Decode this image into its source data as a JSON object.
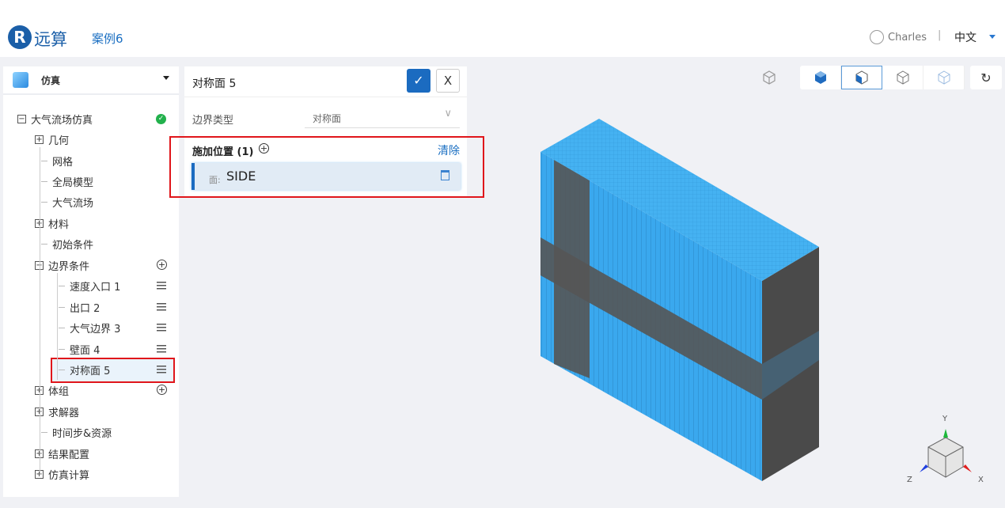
{
  "header": {
    "logo_letter": "R",
    "brand": "远算",
    "case": "案例6",
    "user": "Charles",
    "separator": "|",
    "language": "中文"
  },
  "sidebar": {
    "title": "仿真",
    "tree": [
      {
        "label": "大气流场仿真",
        "toggle": "−",
        "status": "ok"
      },
      {
        "label": "几何",
        "toggle": "+"
      },
      {
        "label": "网格"
      },
      {
        "label": "全局模型"
      },
      {
        "label": "大气流场"
      },
      {
        "label": "材料",
        "toggle": "+"
      },
      {
        "label": "初始条件"
      },
      {
        "label": "边界条件",
        "toggle": "−",
        "action": "add"
      },
      {
        "label": "速度入口 1",
        "action": "menu"
      },
      {
        "label": "出口 2",
        "action": "menu"
      },
      {
        "label": "大气边界 3",
        "action": "menu"
      },
      {
        "label": "壁面 4",
        "action": "menu"
      },
      {
        "label": "对称面 5",
        "action": "menu",
        "selected": true
      },
      {
        "label": "体组",
        "toggle": "+",
        "action": "add"
      },
      {
        "label": "求解器",
        "toggle": "+"
      },
      {
        "label": "时间步&资源"
      },
      {
        "label": "结果配置",
        "toggle": "+"
      },
      {
        "label": "仿真计算",
        "toggle": "+"
      }
    ]
  },
  "panel": {
    "title": "对称面 5",
    "confirm": "✓",
    "close": "X",
    "boundary_type_label": "边界类型",
    "boundary_type_value": "对称面",
    "location_label": "施加位置 (1)",
    "clear": "清除",
    "item_prefix": "面:",
    "item_value": "SIDE"
  },
  "viewport": {
    "view_buttons": [
      "solid",
      "solid-edges",
      "wireframe",
      "points"
    ],
    "active_view": "solid-edges",
    "reset": "↻",
    "axes": {
      "x": "X",
      "y": "Y",
      "z": "Z"
    }
  },
  "colors": {
    "accent": "#1b6bc0",
    "mesh": "#3aa8ee",
    "highlight": "#e0161b",
    "ok": "#22b14c"
  }
}
